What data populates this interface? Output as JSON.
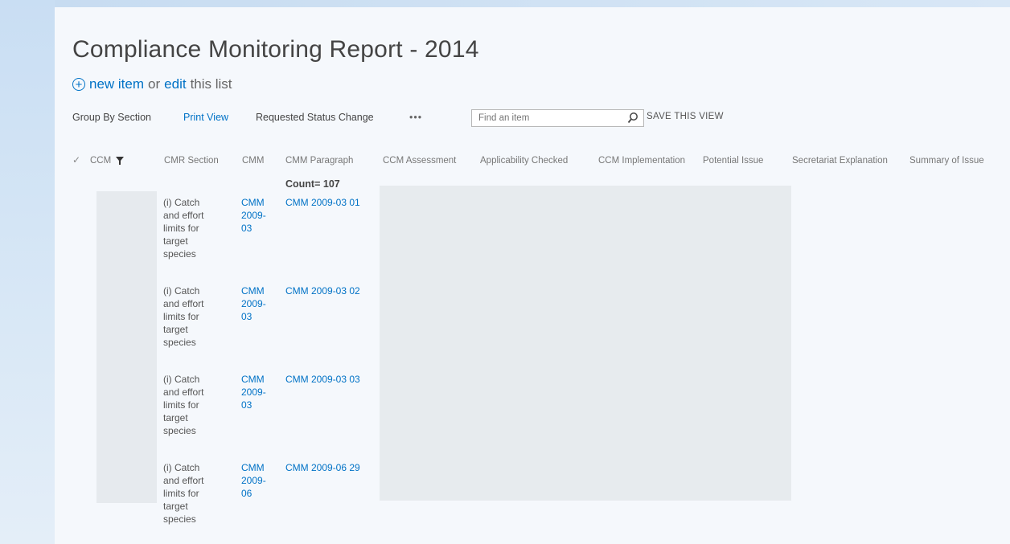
{
  "page": {
    "title": "Compliance Monitoring Report - 2014",
    "new_item": "new item",
    "or_text": "or",
    "edit": "edit",
    "this_list": "this list"
  },
  "toolbar": {
    "group_by": "Group By Section",
    "print_view": "Print View",
    "requested_status": "Requested Status Change",
    "more": "•••",
    "search_placeholder": "Find an item",
    "save_view": "SAVE THIS VIEW"
  },
  "columns": {
    "check": "✓",
    "ccm": "CCM",
    "cmr_section": "CMR Section",
    "cmm": "CMM",
    "cmm_paragraph": "CMM Paragraph",
    "ccm_assessment": "CCM Assessment",
    "applicability": "Applicability Checked",
    "ccm_implementation": "CCM Implementation",
    "potential_issue": "Potential Issue",
    "secretariat": "Secretariat Explanation",
    "summary": "Summary of Issue"
  },
  "count_label": "Count= 107",
  "rows": [
    {
      "section": "(i) Catch and effort limits for target species",
      "cmm": "CMM 2009-03",
      "paragraph": "CMM 2009-03 01"
    },
    {
      "section": "(i) Catch and effort limits for target species",
      "cmm": "CMM 2009-03",
      "paragraph": "CMM 2009-03 02"
    },
    {
      "section": "(i) Catch and effort limits for target species",
      "cmm": "CMM 2009-03",
      "paragraph": "CMM 2009-03 03"
    },
    {
      "section": "(i) Catch and effort limits for target species",
      "cmm": "CMM 2009-06",
      "paragraph": "CMM 2009-06 29"
    }
  ]
}
